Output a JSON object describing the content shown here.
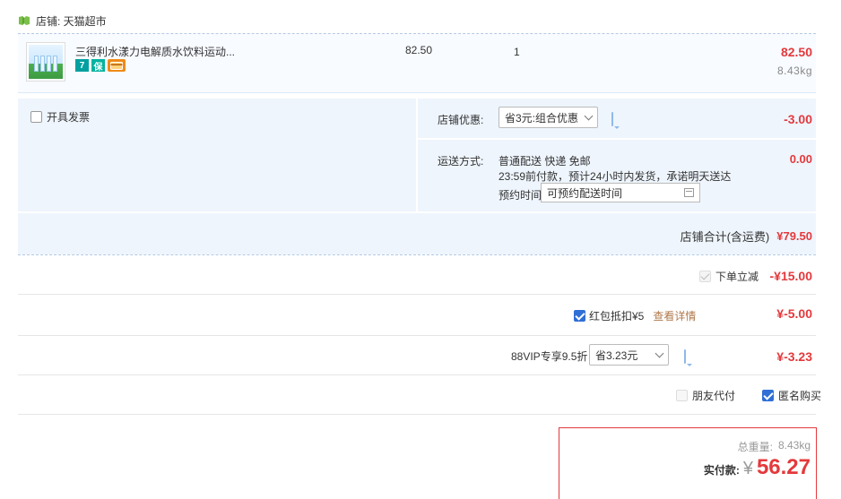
{
  "store": {
    "label": "店铺: 天猫超市",
    "icon": "tmall-store-icon"
  },
  "item": {
    "name": "三得利水漾力电解质水饮料运动...",
    "unit_price": "82.50",
    "quantity": "1",
    "subtotal": "82.50",
    "weight": "8.43kg",
    "badges": [
      "7",
      "保",
      "card"
    ]
  },
  "invoice": {
    "label": "开具发票",
    "checked": false
  },
  "store_discount": {
    "label": "店铺优惠:",
    "selected": "省3元:组合优惠",
    "amount": "-3.00"
  },
  "shipping": {
    "label": "运送方式:",
    "method": "普通配送 快递 免邮",
    "note": "23:59前付款，预计24小时内发货，承诺明天送达",
    "amount": "0.00",
    "schedule_label": "预约时间",
    "schedule_placeholder": "可预约配送时间"
  },
  "store_total": {
    "label": "店铺合计(含运费)",
    "amount": "¥79.50"
  },
  "instant_discount": {
    "label": "下单立减",
    "amount": "-¥15.00"
  },
  "red_packet": {
    "label": "红包抵扣¥5",
    "link": "查看详情",
    "amount": "¥-5.00",
    "checked": true
  },
  "vip": {
    "label": "88VIP专享9.5折",
    "selected": "省3.23元",
    "amount": "¥-3.23"
  },
  "options": {
    "friend_pay": "朋友代付",
    "anonymous": "匿名购买"
  },
  "summary": {
    "weight_label": "总重量:",
    "weight_value": "8.43kg",
    "pay_label": "实付款:",
    "currency": "¥",
    "pay_amount": "56.27"
  },
  "colors": {
    "accent_red": "#e4393c",
    "checkbox_blue": "#2f6fd6",
    "row_bg": "#eef5fd",
    "link_brown": "#b0784a"
  }
}
